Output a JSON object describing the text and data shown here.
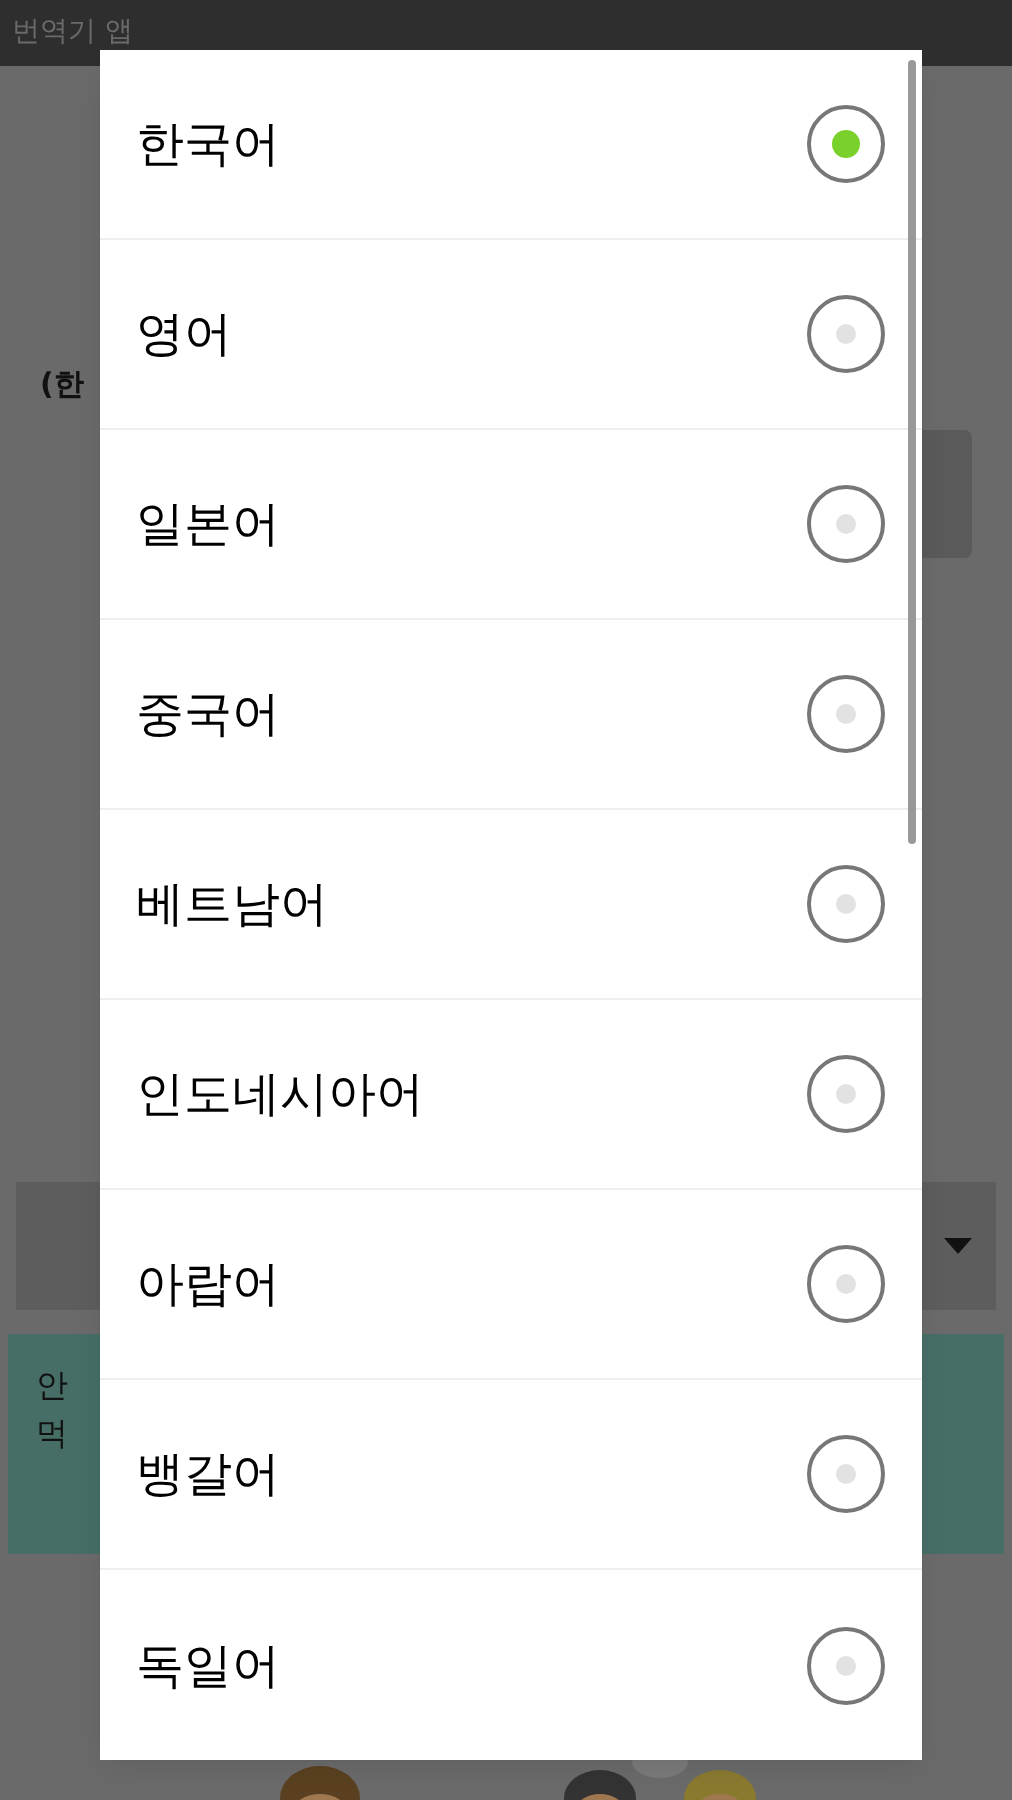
{
  "app_title": "번역기 앱",
  "background": {
    "label_fragment": "(한",
    "note_fragments": [
      "안",
      "먹"
    ]
  },
  "language_dialog": {
    "options": [
      {
        "label": "한국어",
        "selected": true
      },
      {
        "label": "영어",
        "selected": false
      },
      {
        "label": "일본어",
        "selected": false
      },
      {
        "label": "중국어",
        "selected": false
      },
      {
        "label": "베트남어",
        "selected": false
      },
      {
        "label": "인도네시아어",
        "selected": false
      },
      {
        "label": "아랍어",
        "selected": false
      },
      {
        "label": "뱅갈어",
        "selected": false
      },
      {
        "label": "독일어",
        "selected": false
      }
    ]
  }
}
